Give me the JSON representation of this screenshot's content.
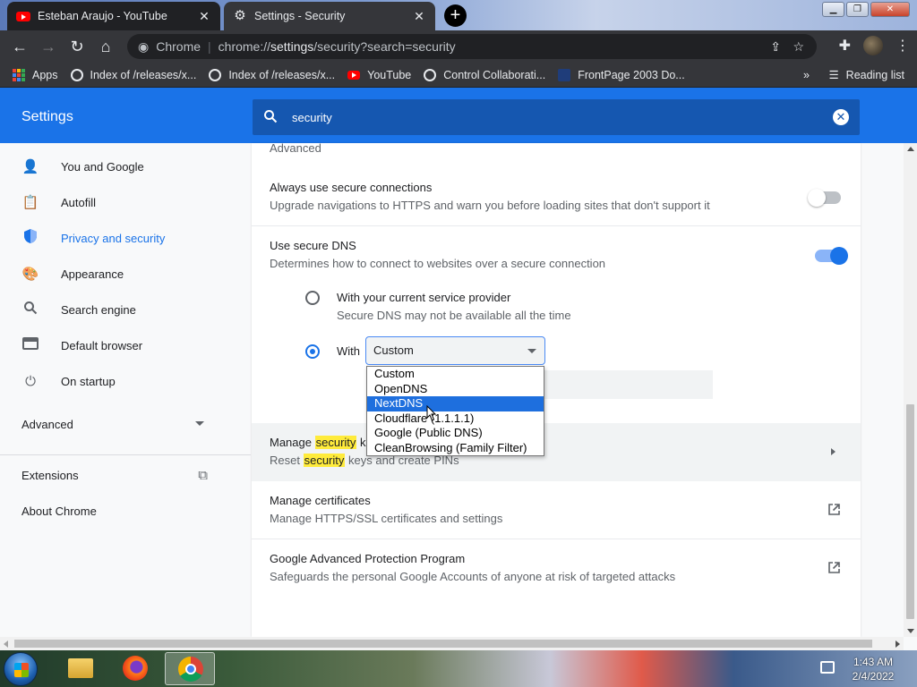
{
  "tabs": [
    {
      "title": "Esteban Araujo - YouTube",
      "favicon": "youtube-icon"
    },
    {
      "title": "Settings - Security",
      "favicon": "gear-icon"
    }
  ],
  "toolbar": {
    "site_label": "Chrome",
    "url_scheme": "chrome://",
    "url_host": "settings",
    "url_path": "/security?search=security"
  },
  "bookmarks": {
    "items": [
      "Apps",
      "Index of /releases/x...",
      "Index of /releases/x...",
      "YouTube",
      "Control Collaborati...",
      "FrontPage 2003 Do..."
    ],
    "reading_list": "Reading list",
    "overflow": "»"
  },
  "header": {
    "title": "Settings",
    "search_value": "security"
  },
  "sidebar": {
    "items": [
      {
        "label": "You and Google",
        "icon": "person-icon"
      },
      {
        "label": "Autofill",
        "icon": "clipboard-icon"
      },
      {
        "label": "Privacy and security",
        "icon": "shield-icon"
      },
      {
        "label": "Appearance",
        "icon": "palette-icon"
      },
      {
        "label": "Search engine",
        "icon": "search-icon"
      },
      {
        "label": "Default browser",
        "icon": "browser-icon"
      },
      {
        "label": "On startup",
        "icon": "power-icon"
      }
    ],
    "advanced": "Advanced",
    "extensions": "Extensions",
    "about": "About Chrome"
  },
  "main": {
    "section_heading": "Advanced",
    "secure_connections": {
      "title": "Always use secure connections",
      "subtitle": "Upgrade navigations to HTTPS and warn you before loading sites that don't support it",
      "enabled": false
    },
    "secure_dns": {
      "title": "Use secure DNS",
      "subtitle": "Determines how to connect to websites over a secure connection",
      "enabled": true,
      "option_current": {
        "title": "With your current service provider",
        "subtitle": "Secure DNS may not be available all the time"
      },
      "option_with": {
        "label": "With",
        "selected": "Custom"
      },
      "dropdown_options": [
        "Custom",
        "OpenDNS",
        "NextDNS",
        "Cloudflare (1.1.1.1)",
        "Google (Public DNS)",
        "CleanBrowsing (Family Filter)"
      ],
      "highlighted_option": "NextDNS"
    },
    "manage_keys": {
      "title_pre": "Manage",
      "title_mark": "security",
      "title_post": "keys",
      "subtitle_pre": "Reset",
      "subtitle_mark": "security",
      "subtitle_post": "keys and create PINs"
    },
    "certificates": {
      "title": "Manage certificates",
      "subtitle": "Manage HTTPS/SSL certificates and settings"
    },
    "advanced_protection": {
      "title": "Google Advanced Protection Program",
      "subtitle": "Safeguards the personal Google Accounts of anyone at risk of targeted attacks"
    }
  },
  "taskbar": {
    "time": "1:43 AM",
    "date": "2/4/2022"
  }
}
